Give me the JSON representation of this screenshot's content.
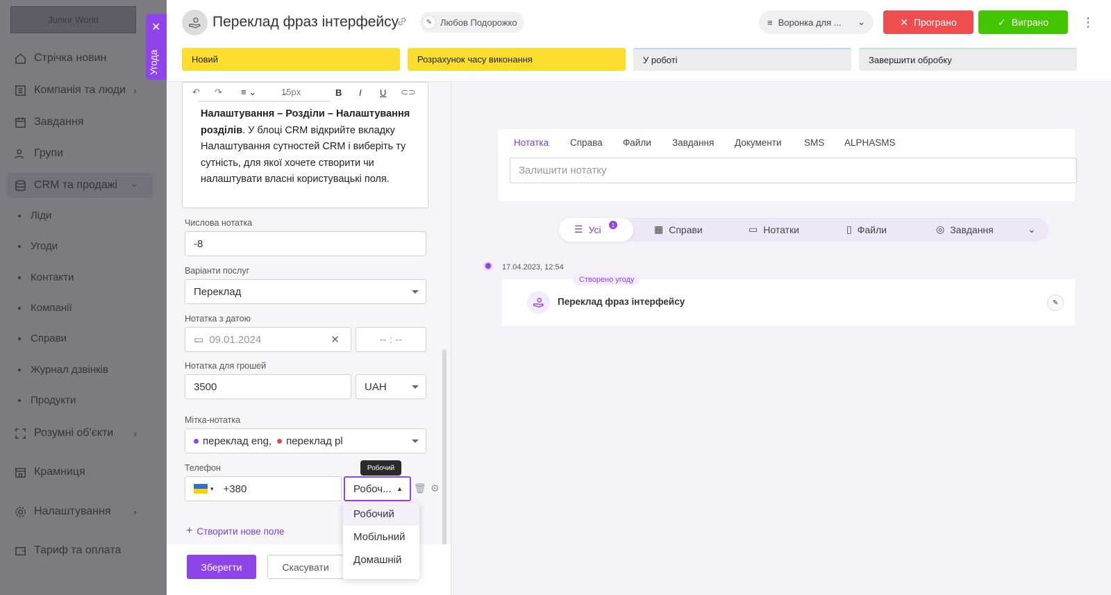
{
  "sidebar": {
    "logo": "Junior World",
    "items": [
      {
        "label": "Стрічка новин"
      },
      {
        "label": "Компанія та люди"
      },
      {
        "label": "Завдання"
      },
      {
        "label": "Групи"
      },
      {
        "label": "CRM та продажі"
      },
      {
        "label": "Розумні об'єкти"
      },
      {
        "label": "Крамниця"
      },
      {
        "label": "Налаштування"
      },
      {
        "label": "Тариф та оплата"
      }
    ],
    "crm_subitems": [
      "Ліди",
      "Угоди",
      "Контакти",
      "Компанії",
      "Справи",
      "Журнал дзвінків",
      "Продукти"
    ]
  },
  "pull_tab": {
    "label": "Угода"
  },
  "header": {
    "title": "Переклад фраз інтерфейсу",
    "owner": "Любов Подорожко",
    "funnel": "Воронка для ...",
    "lost_label": "Програно",
    "won_label": "Виграно",
    "stages": [
      "Новий",
      "Розрахунок часу виконання",
      "У роботі",
      "Завершити обробку"
    ]
  },
  "form": {
    "editor": {
      "font_size": "15px",
      "text_bold": "Налаштування – Розділи – Налаштування розділів",
      "text_rest": ". У блоці CRM відкрийте вкладку Налаштування сутностей CRM і виберіть ту сутність, для якої хочете створити чи налаштувати власні користувацькі поля."
    },
    "numeric_label": "Числова нотатка",
    "numeric_value": "-8",
    "services_label": "Варіанти послуг",
    "services_value": "Переклад",
    "date_label": "Нотатка з датою",
    "date_value": "09.01.2024",
    "time_value": "-- : --",
    "money_label": "Нотатка для грошей",
    "money_value": "3500",
    "currency": "UAH",
    "tag_label": "Мітка-нотатка",
    "tags": [
      {
        "label": "переклад eng,",
        "color": "#8e44e8"
      },
      {
        "label": "переклад pl",
        "color": "#e04848"
      }
    ],
    "phone_label": "Телефон",
    "phone_code": "+380",
    "phone_type": "Робоч...",
    "tooltip": "Робочий",
    "phone_types": [
      "Робочий",
      "Мобільний",
      "Домашній"
    ],
    "create_field": "Створити нове поле",
    "save": "Зберегти",
    "cancel": "Скасувати"
  },
  "activity": {
    "tabs": [
      "Нотатка",
      "Справа",
      "Файли",
      "Завдання",
      "Документи",
      "SMS",
      "ALPHASMS"
    ],
    "note_placeholder": "Залишити нотатку",
    "filters": [
      "Усі",
      "Справи",
      "Нотатки",
      "Файли",
      "Завдання"
    ],
    "all_count": "1",
    "timeline": {
      "date": "17.04.2023, 12:54",
      "tag": "Створено угоду",
      "title": "Переклад фраз інтерфейсу"
    }
  }
}
